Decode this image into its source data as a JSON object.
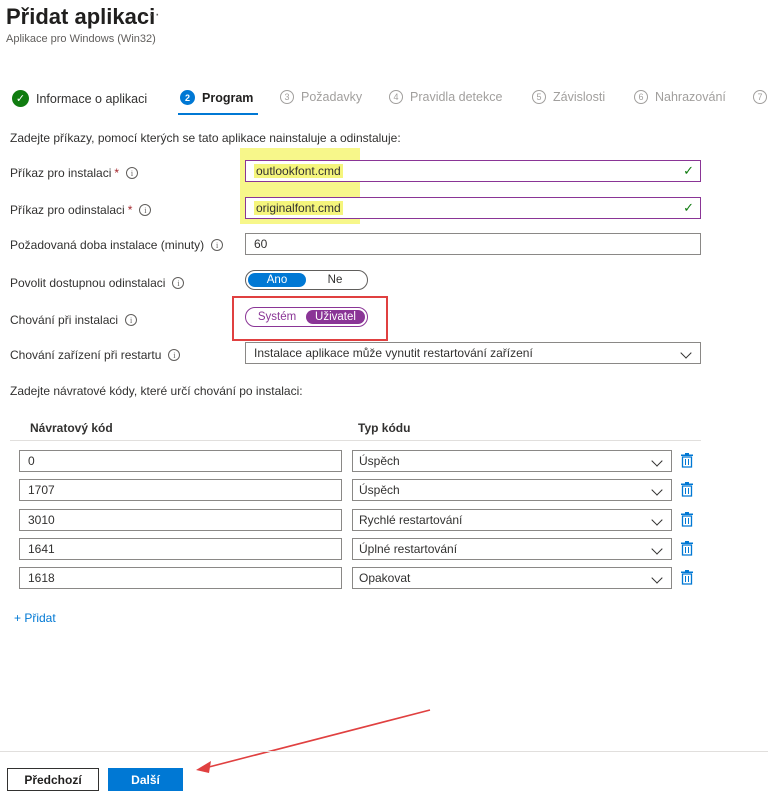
{
  "header": {
    "title": "Přidat aplikaci",
    "more": "···",
    "subtitle": "Aplikace pro Windows (Win32)"
  },
  "steps": [
    {
      "num": "✓",
      "label": "Informace o aplikaci",
      "state": "done"
    },
    {
      "num": "2",
      "label": "Program",
      "state": "active"
    },
    {
      "num": "3",
      "label": "Požadavky",
      "state": "pending"
    },
    {
      "num": "4",
      "label": "Pravidla detekce",
      "state": "pending"
    },
    {
      "num": "5",
      "label": "Závislosti",
      "state": "pending"
    },
    {
      "num": "6",
      "label": "Nahrazování",
      "state": "pending"
    },
    {
      "num": "7",
      "label": "",
      "state": "pending"
    }
  ],
  "program": {
    "intro": "Zadejte příkazy, pomocí kterých se tato aplikace nainstaluje a odinstaluje:",
    "install_label": "Příkaz pro instalaci",
    "install_value": "outlookfont.cmd",
    "uninstall_label": "Příkaz pro odinstalaci",
    "uninstall_value": "originalfont.cmd",
    "duration_label": "Požadovaná doba instalace (minuty)",
    "duration_value": "60",
    "allow_uninstall_label": "Povolit dostupnou odinstalaci",
    "allow_uninstall_options": [
      "Ano",
      "Ne"
    ],
    "allow_uninstall_selected": "Ano",
    "behavior_label": "Chování při instalaci",
    "behavior_options": [
      "Systém",
      "Uživatel"
    ],
    "behavior_selected": "Uživatel",
    "restart_label": "Chování zařízení při restartu",
    "restart_value": "Instalace aplikace může vynutit restartování zařízení",
    "required_mark": "*",
    "info_icon": "i",
    "valid_icon": "✓"
  },
  "return_codes": {
    "intro": "Zadejte návratové kódy, které určí chování po instalaci:",
    "col_code": "Návratový kód",
    "col_type": "Typ kódu",
    "rows": [
      {
        "code": "0",
        "type": "Úspěch"
      },
      {
        "code": "1707",
        "type": "Úspěch"
      },
      {
        "code": "3010",
        "type": "Rychlé restartování"
      },
      {
        "code": "1641",
        "type": "Úplné restartování"
      },
      {
        "code": "1618",
        "type": "Opakovat"
      }
    ],
    "add_label": "+ Přidat"
  },
  "footer": {
    "prev_label": "Předchozí",
    "next_label": "Další"
  },
  "colors": {
    "accent": "#0078d4",
    "success": "#107c10",
    "purple": "#8a3596",
    "highlight": "#f7f78a",
    "annotation_red": "#e04040"
  }
}
